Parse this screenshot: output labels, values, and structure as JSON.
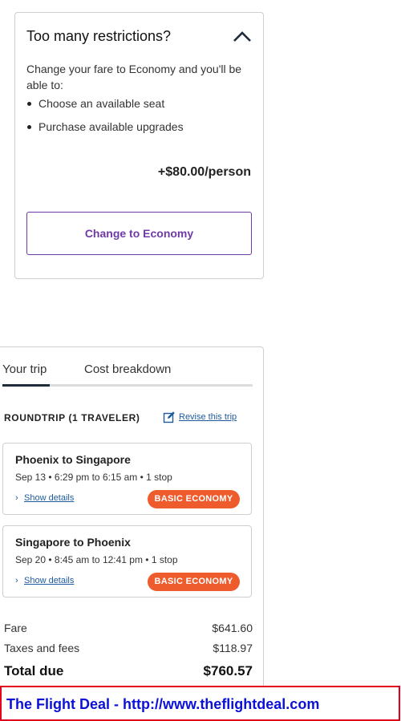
{
  "restrictions": {
    "title": "Too many restrictions?",
    "description": "Change your fare to Economy and you'll be able to:",
    "items": [
      "Choose an available seat",
      "Purchase available upgrades"
    ],
    "price": "+$80.00/person",
    "button_label": "Change to Economy",
    "accent_color": "#6e3aa7"
  },
  "trip": {
    "tabs": [
      "Your trip",
      "Cost breakdown"
    ],
    "active_tab": "Your trip",
    "header": "ROUNDTRIP (1 TRAVELER)",
    "revise_label": "Revise this trip",
    "flights": [
      {
        "route": "Phoenix to Singapore",
        "details": "Sep 13 • 6:29 pm to 6:15 am • 1 stop",
        "show_details": "Show details",
        "badge": "BASIC ECONOMY"
      },
      {
        "route": "Singapore to Phoenix",
        "details": "Sep 20 • 8:45 am to 12:41 pm • 1 stop",
        "show_details": "Show details",
        "badge": "BASIC ECONOMY"
      }
    ],
    "badge_color": "#ee5b2c",
    "fare_label": "Fare",
    "fare_value": "$641.60",
    "taxes_label": "Taxes and fees",
    "taxes_value": "$118.97",
    "total_label": "Total due",
    "total_value": "$760.57"
  },
  "banner": {
    "text": "The Flight Deal - http://www.theflightdeal.com",
    "border_color": "#e3001b",
    "text_color": "#0b12d6"
  }
}
